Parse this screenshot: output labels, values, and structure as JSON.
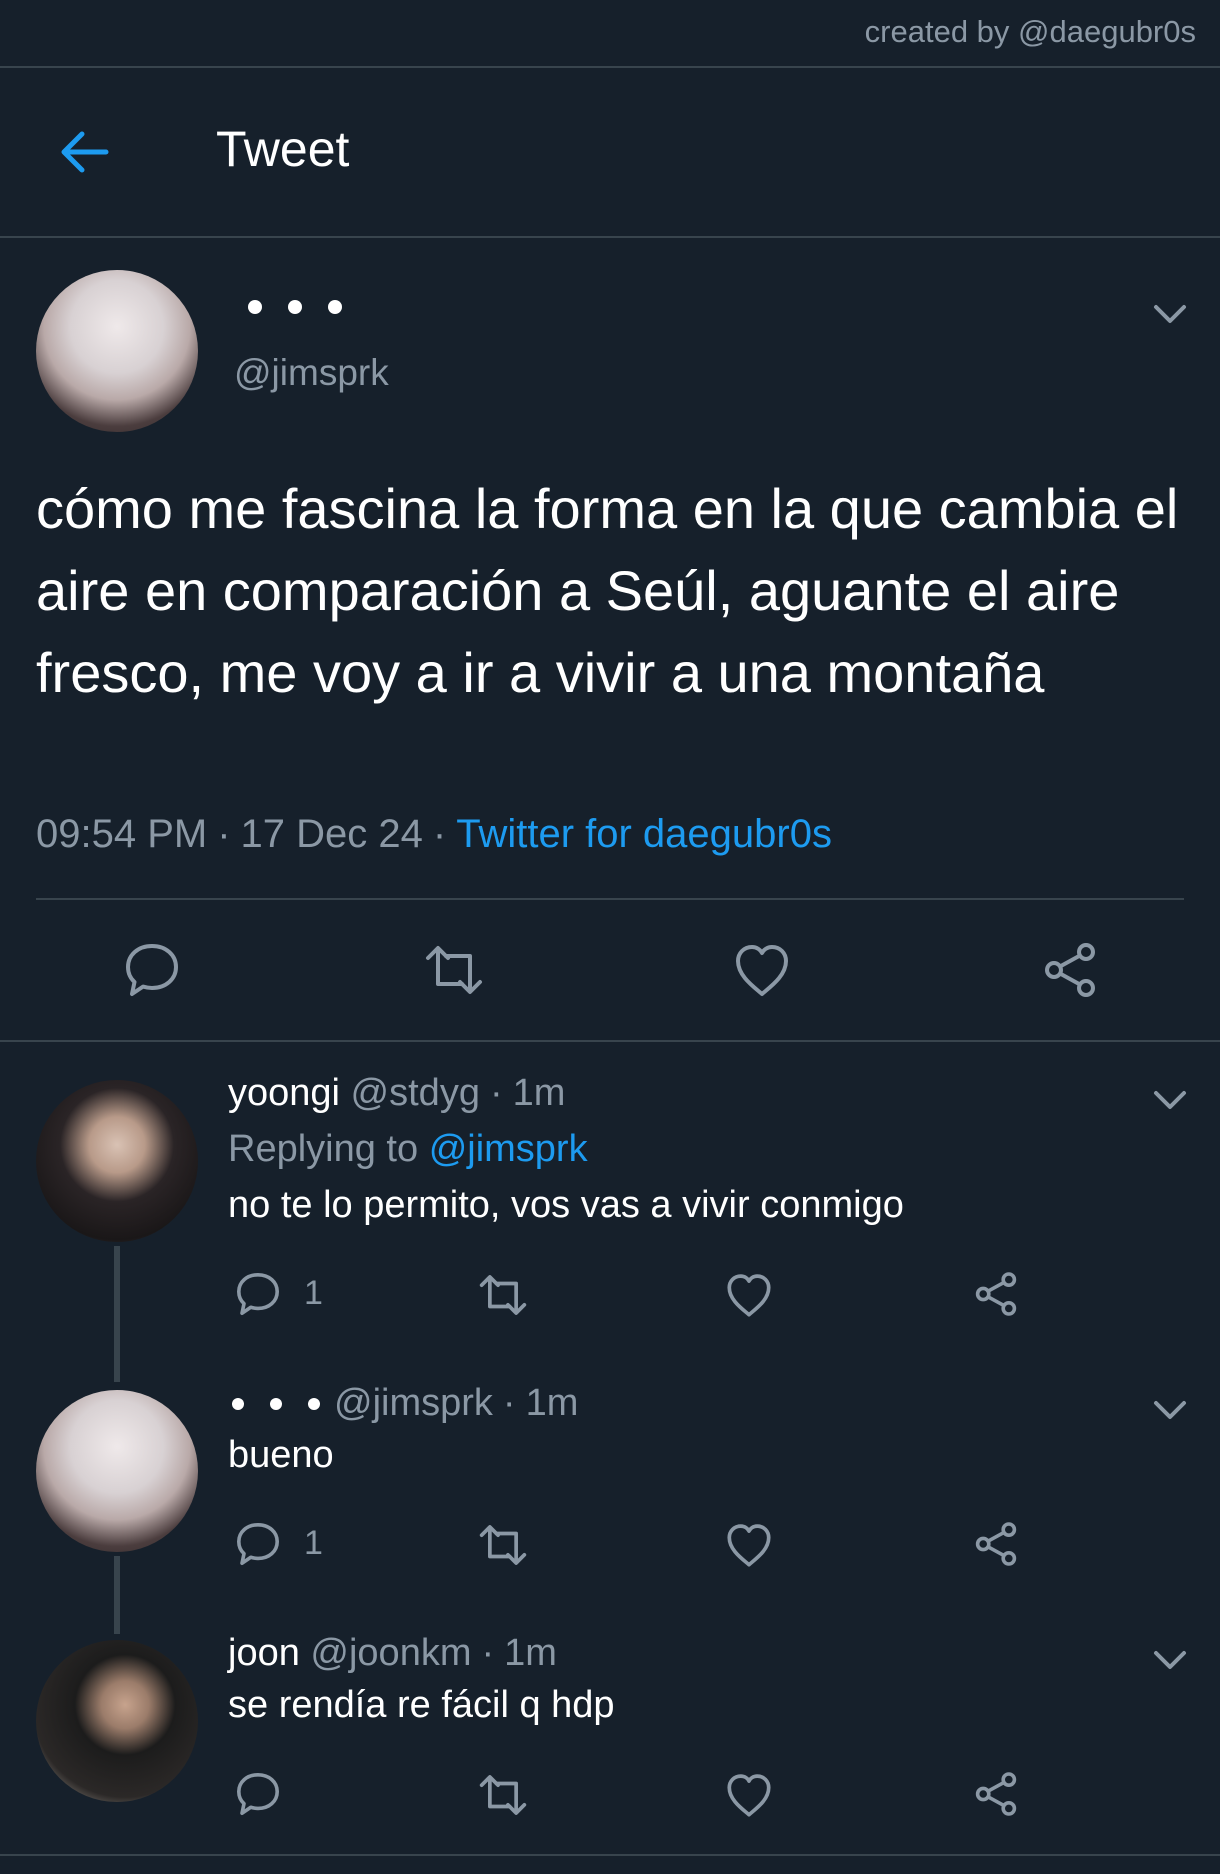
{
  "watermark": "created by @daegubr0s",
  "header": {
    "title": "Tweet"
  },
  "main_tweet": {
    "handle": "@jimsprk",
    "text": "cómo me fascina la forma en la que cambia el aire en comparación a Seúl, aguante el aire fresco, me voy a ir a vivir a una montaña",
    "time": "09:54 PM",
    "date": "17 Dec 24",
    "separator": "·",
    "source": "Twitter for daegubr0s"
  },
  "replies": [
    {
      "name": "yoongi",
      "handle": "@stdyg",
      "separator": "·",
      "time": "1m",
      "replying_label": "Replying to",
      "replying_to": "@jimsprk",
      "text": "no te lo permito, vos vas a vivir conmigo",
      "reply_count": "1"
    },
    {
      "handle": "@jimsprk",
      "separator": "·",
      "time": "1m",
      "text": "bueno",
      "reply_count": "1"
    },
    {
      "name": "joon",
      "handle": "@joonkm",
      "separator": "·",
      "time": "1m",
      "text": "se rendía re fácil q hdp"
    }
  ],
  "icons": {
    "back": "arrow-left-icon",
    "chevron": "chevron-down-icon",
    "reply": "comment-icon",
    "retweet": "retweet-icon",
    "like": "heart-icon",
    "share": "share-icon"
  },
  "colors": {
    "background": "#16202b",
    "divider": "#38444d",
    "accent": "#1d9bf0",
    "secondary_text": "#8b98a5"
  }
}
